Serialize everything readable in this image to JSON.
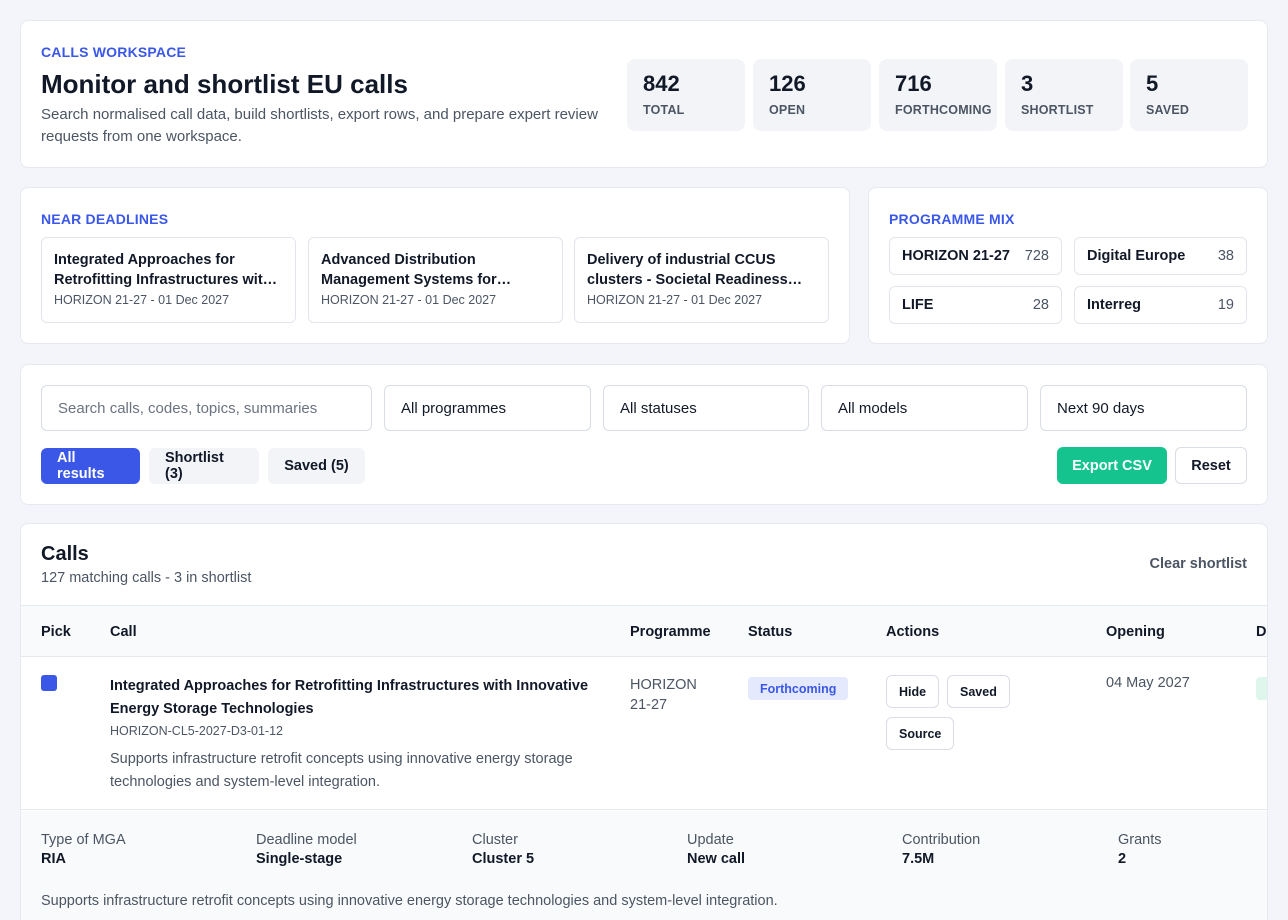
{
  "header": {
    "eyebrow": "CALLS WORKSPACE",
    "title": "Monitor and shortlist EU calls",
    "description": "Search normalised call data, build shortlists, export rows, and prepare expert review requests from one workspace.",
    "stats": [
      {
        "value": "842",
        "label": "TOTAL"
      },
      {
        "value": "126",
        "label": "OPEN"
      },
      {
        "value": "716",
        "label": "FORTHCOMING"
      },
      {
        "value": "3",
        "label": "SHORTLIST"
      },
      {
        "value": "5",
        "label": "SAVED"
      }
    ]
  },
  "near_deadlines": {
    "title": "NEAR DEADLINES",
    "items": [
      {
        "title": "Integrated Approaches for Retrofitting Infrastructures with Innovative Energy Storage Technologies",
        "meta": "HORIZON 21-27 - 01 Dec 2027"
      },
      {
        "title": "Advanced Distribution Management Systems for flexible grids",
        "meta": "HORIZON 21-27 - 01 Dec 2027"
      },
      {
        "title": "Delivery of industrial CCUS clusters - Societal Readiness Pilots",
        "meta": "HORIZON 21-27 - 01 Dec 2027"
      }
    ]
  },
  "programme_mix": {
    "title": "PROGRAMME MIX",
    "items": [
      {
        "name": "HORIZON 21-27",
        "count": "728"
      },
      {
        "name": "Digital Europe",
        "count": "38"
      },
      {
        "name": "LIFE",
        "count": "28"
      },
      {
        "name": "Interreg",
        "count": "19"
      }
    ]
  },
  "filters": {
    "search_placeholder": "Search calls, codes, topics, summaries",
    "programme": "All programmes",
    "status": "All statuses",
    "model": "All models",
    "range": "Next 90 days",
    "tabs": [
      "All results",
      "Shortlist (3)",
      "Saved (5)"
    ],
    "export_label": "Export CSV",
    "reset_label": "Reset"
  },
  "calls": {
    "title": "Calls",
    "subtitle": "127 matching calls - 3 in shortlist",
    "clear_label": "Clear shortlist",
    "columns": [
      "Pick",
      "Call",
      "Programme",
      "Status",
      "Actions",
      "Opening",
      "De"
    ],
    "rows": [
      {
        "title": "Integrated Approaches for Retrofitting Infrastructures with Innovative Energy Storage Technologies",
        "code": "HORIZON-CL5-2027-D3-01-12",
        "summary": "Supports infrastructure retrofit concepts using innovative energy storage technologies and system-level integration.",
        "programme": "HORIZON 21-27",
        "status": "Forthcoming",
        "actions": [
          "Hide",
          "Saved",
          "Source"
        ],
        "opening": "04 May 2027"
      }
    ],
    "detail": {
      "fields": [
        {
          "key": "Type of MGA",
          "value": "RIA"
        },
        {
          "key": "Deadline model",
          "value": "Single-stage"
        },
        {
          "key": "Cluster",
          "value": "Cluster 5"
        },
        {
          "key": "Update",
          "value": "New call"
        },
        {
          "key": "Contribution",
          "value": "7.5M"
        },
        {
          "key": "Grants",
          "value": "2"
        }
      ],
      "summary": "Supports infrastructure retrofit concepts using innovative energy storage technologies and system-level integration."
    }
  },
  "colors": {
    "accent": "#3b57e8",
    "export": "#14c38e",
    "badge_bg": "#e4e9fd"
  }
}
